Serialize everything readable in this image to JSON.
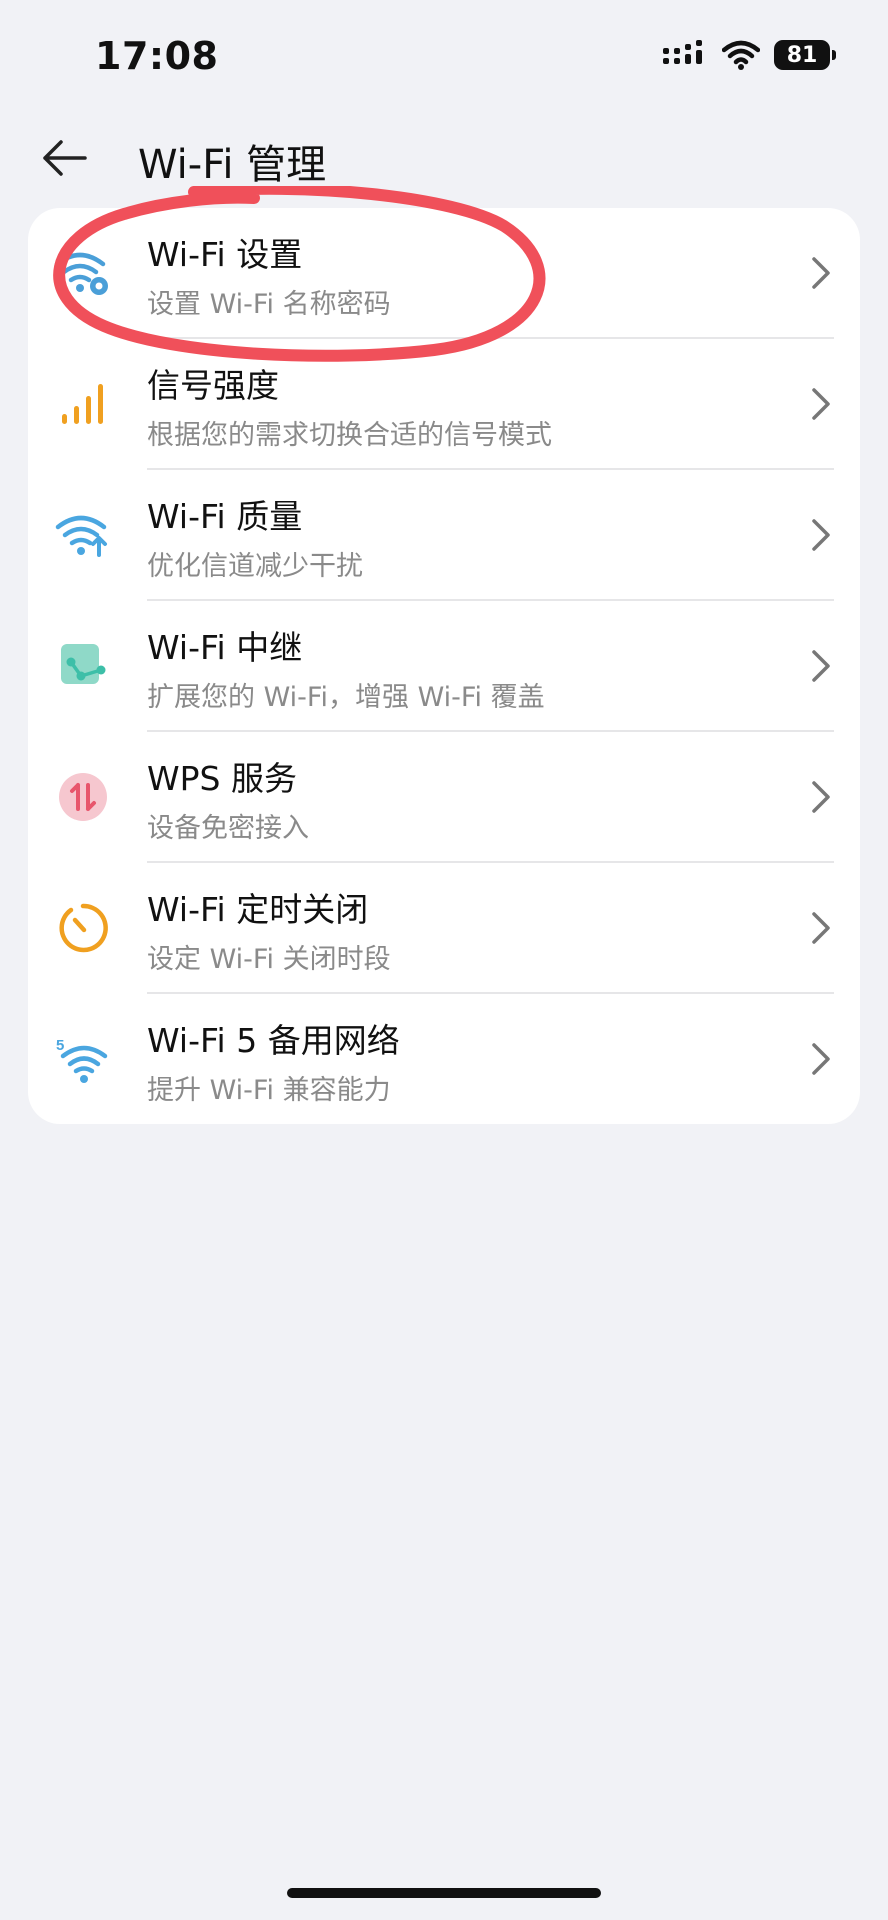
{
  "status_bar": {
    "time": "17:08",
    "battery": "81"
  },
  "header": {
    "title": "Wi-Fi 管理"
  },
  "items": [
    {
      "title": "Wi-Fi 设置",
      "subtitle": "设置 Wi-Fi 名称密码",
      "icon": "wifi-settings-icon",
      "color": "#4a9fd8"
    },
    {
      "title": "信号强度",
      "subtitle": "根据您的需求切换合适的信号模式",
      "icon": "signal-strength-icon",
      "color": "#f0a020"
    },
    {
      "title": "Wi-Fi 质量",
      "subtitle": "优化信道减少干扰",
      "icon": "wifi-quality-icon",
      "color": "#4aa6e0"
    },
    {
      "title": "Wi-Fi 中继",
      "subtitle": "扩展您的 Wi-Fi，增强 Wi-Fi 覆盖",
      "icon": "wifi-relay-icon",
      "color": "#3dbfa8"
    },
    {
      "title": "WPS 服务",
      "subtitle": "设备免密接入",
      "icon": "wps-icon",
      "color": "#e8566c"
    },
    {
      "title": "Wi-Fi 定时关闭",
      "subtitle": "设定 Wi-Fi 关闭时段",
      "icon": "timer-icon",
      "color": "#f0a020"
    },
    {
      "title": "Wi-Fi 5 备用网络",
      "subtitle": "提升 Wi-Fi 兼容能力",
      "icon": "wifi-5-backup-icon",
      "color": "#4aa6e0"
    }
  ],
  "annotation_color": "#f0505a"
}
